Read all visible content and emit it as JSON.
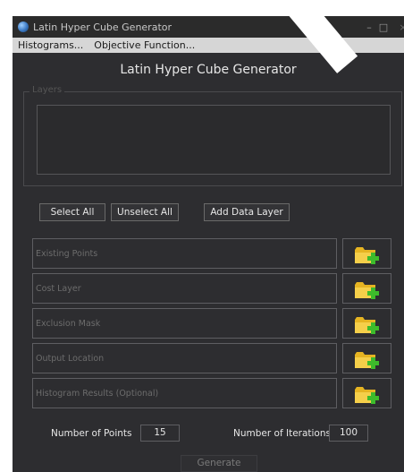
{
  "window": {
    "title": "Latin Hyper Cube Generator",
    "controls": {
      "minimize": "–",
      "maximize": "□",
      "close": "×"
    }
  },
  "menu": {
    "items": [
      "Histograms...",
      "Objective Function..."
    ]
  },
  "main": {
    "heading": "Latin Hyper Cube Generator",
    "layers_group_label": "Layers",
    "buttons": {
      "select_all": "Select All",
      "unselect_all": "Unselect All",
      "add_data_layer": "Add Data Layer",
      "generate": "Generate"
    },
    "fields": [
      {
        "placeholder": "Existing Points",
        "icon": "add-folder-icon"
      },
      {
        "placeholder": "Cost Layer",
        "icon": "add-folder-icon"
      },
      {
        "placeholder": "Exclusion Mask",
        "icon": "add-folder-icon"
      },
      {
        "placeholder": "Output Location",
        "icon": "add-folder-icon"
      },
      {
        "placeholder": "Histogram Results (Optional)",
        "icon": "add-folder-icon"
      }
    ],
    "params": {
      "points_label": "Number of Points",
      "points_value": "15",
      "iterations_label": "Number of Iterations",
      "iterations_value": "100"
    }
  },
  "colors": {
    "background": "#2d2d30",
    "menubar": "#d6d6d6",
    "folder": "#f0c419",
    "plus": "#3dbb2b"
  }
}
